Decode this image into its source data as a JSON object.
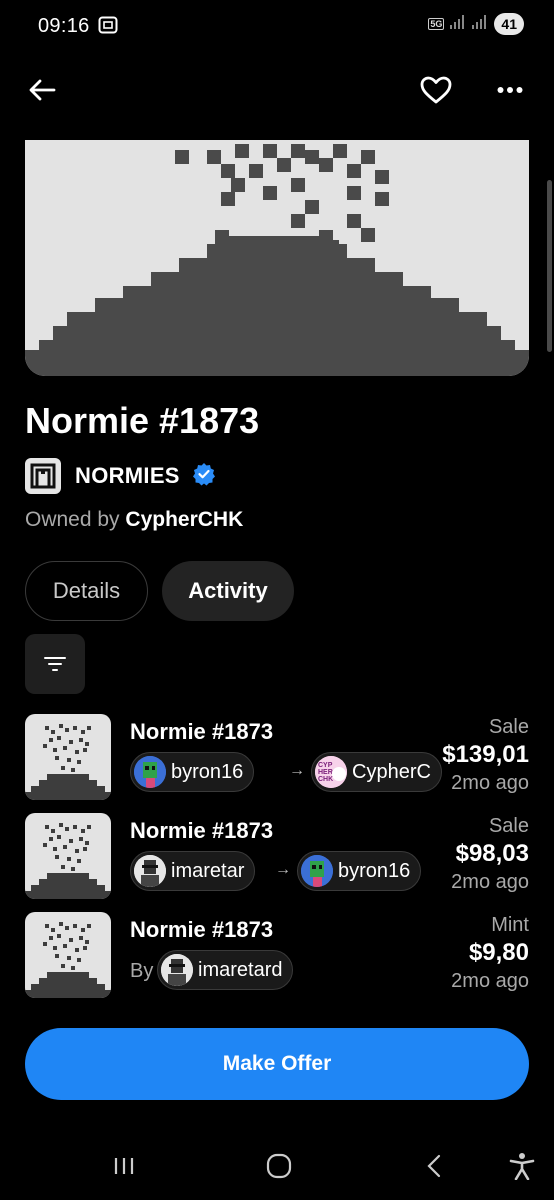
{
  "status_bar": {
    "time": "09:16",
    "network": "5G",
    "battery": "41"
  },
  "icons": {
    "back": "arrow-left-icon",
    "favorite": "heart-icon",
    "more": "more-horizontal-icon",
    "filter": "filter-lines-icon",
    "verified": "verified-badge-icon"
  },
  "item": {
    "title": "Normie #1873"
  },
  "collection": {
    "name": "NORMIES"
  },
  "owner": {
    "prefix": "Owned by",
    "name": "CypherCHK"
  },
  "tabs": [
    {
      "label": "Details",
      "active": false
    },
    {
      "label": "Activity",
      "active": true
    }
  ],
  "activity": [
    {
      "name": "Normie #1873",
      "from": "byron16",
      "to": "CypherC",
      "type": "Sale",
      "price": "$139,01",
      "time": "2mo ago"
    },
    {
      "name": "Normie #1873",
      "from": "imaretar",
      "to": "byron16",
      "type": "Sale",
      "price": "$98,03",
      "time": "2mo ago"
    },
    {
      "name": "Normie #1873",
      "by_label": "By",
      "by": "imaretard",
      "type": "Mint",
      "price": "$9,80",
      "time": "2mo ago"
    }
  ],
  "actions": {
    "make_offer": "Make Offer"
  },
  "colors": {
    "accent": "#1f86f5",
    "background": "#000000",
    "verified": "#2a8cf7"
  }
}
